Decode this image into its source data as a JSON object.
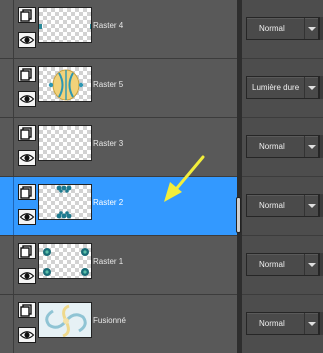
{
  "layers": [
    {
      "name": "Raster 4",
      "blend_mode": "Normal",
      "active": false,
      "thumbnail": "teal-strip"
    },
    {
      "name": "Raster 5",
      "blend_mode": "Lumière dure",
      "active": false,
      "thumbnail": "yellow-orb"
    },
    {
      "name": "Raster 3",
      "blend_mode": "Normal",
      "active": false,
      "thumbnail": "empty"
    },
    {
      "name": "Raster 2",
      "blend_mode": "Normal",
      "active": true,
      "thumbnail": "teal-dots"
    },
    {
      "name": "Raster 1",
      "blend_mode": "Normal",
      "active": false,
      "thumbnail": "flowers"
    },
    {
      "name": "Fusionné",
      "blend_mode": "Normal",
      "active": false,
      "thumbnail": "swirl"
    }
  ],
  "icons": {
    "layer_type": "raster-layer-icon",
    "visibility": "eye-icon",
    "dropdown": "chevron-down-icon",
    "annotation": "yellow-arrow-icon"
  },
  "colors": {
    "selection": "#3399ff",
    "panel": "#595959",
    "annotation_arrow": "#f2ee3b"
  }
}
